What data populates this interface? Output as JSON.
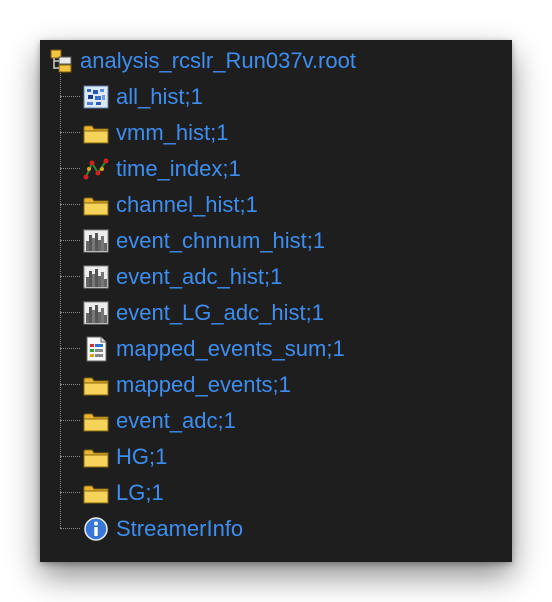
{
  "root": {
    "label": "analysis_rcslr_Run037v.root",
    "icon": "root-file-icon"
  },
  "items": [
    {
      "label": "all_hist;1",
      "icon": "histogram-2d-icon"
    },
    {
      "label": "vmm_hist;1",
      "icon": "folder-icon"
    },
    {
      "label": "time_index;1",
      "icon": "tree-icon"
    },
    {
      "label": "channel_hist;1",
      "icon": "folder-icon"
    },
    {
      "label": "event_chnnum_hist;1",
      "icon": "histogram-1d-icon"
    },
    {
      "label": "event_adc_hist;1",
      "icon": "histogram-1d-icon"
    },
    {
      "label": "event_LG_adc_hist;1",
      "icon": "histogram-1d-icon"
    },
    {
      "label": "mapped_events_sum;1",
      "icon": "ntuple-icon"
    },
    {
      "label": "mapped_events;1",
      "icon": "folder-icon"
    },
    {
      "label": "event_adc;1",
      "icon": "folder-icon"
    },
    {
      "label": "HG;1",
      "icon": "folder-icon"
    },
    {
      "label": "LG;1",
      "icon": "folder-icon"
    },
    {
      "label": "StreamerInfo",
      "icon": "info-icon"
    }
  ],
  "colors": {
    "panel_background": "#1e1e1e",
    "label_text": "#3d8ef0",
    "connector": "#8a8a8a",
    "folder": "#f2c440"
  }
}
